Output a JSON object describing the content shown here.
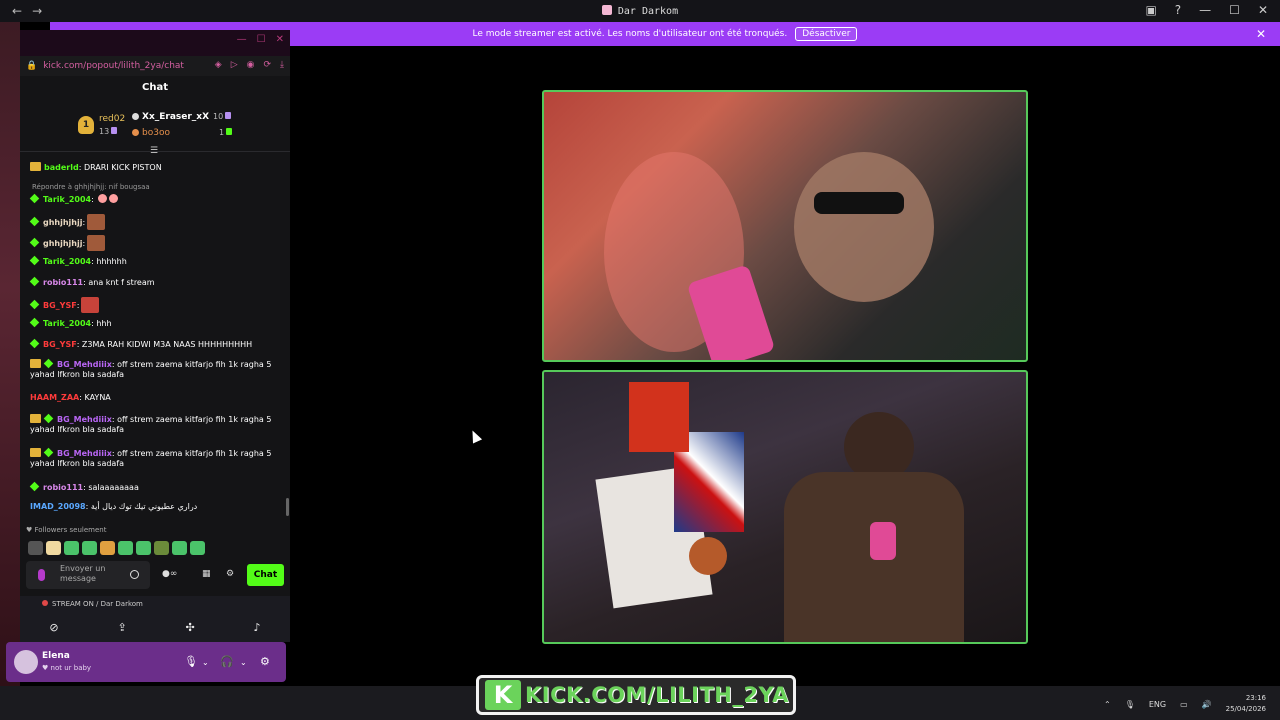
{
  "window": {
    "title": "Dar Darkom"
  },
  "banner": {
    "text": "Le mode streamer est activé. Les noms d'utilisateur ont été tronqués.",
    "button": "Désactiver"
  },
  "chat": {
    "url": "kick.com/popout/lilith_2ya/chat",
    "header": "Chat",
    "leaderboard": {
      "first": {
        "rank": "1",
        "name": "red02",
        "count": "13"
      },
      "second": {
        "name": "Xx_Eraser_xX",
        "count": "10"
      },
      "third": {
        "name": "bo3oo",
        "count": "1"
      }
    },
    "messages": [
      {
        "user": "baderld",
        "text": ": DRARI KICK PISTON"
      },
      {
        "reply": "Répondre à ghhjhjhjj: nif bougsaa"
      },
      {
        "user": "Tarik_2004",
        "text": ": "
      },
      {
        "user": "ghhjhjhjj",
        "text": ":"
      },
      {
        "user": "ghhjhjhjj",
        "text": ":"
      },
      {
        "user": "Tarik_2004",
        "text": ": hhhhhh"
      },
      {
        "user": "robio111",
        "text": ": ana knt f stream"
      },
      {
        "user": "BG_YSF",
        "text": ":"
      },
      {
        "user": "Tarik_2004",
        "text": ": hhh"
      },
      {
        "user": "BG_YSF",
        "text": ": Z3MA RAH KIDWI M3A NAAS HHHHHHHHH"
      },
      {
        "user": "BG_Mehdiiix",
        "text": ": off strem zaema kitfarjo fih 1k ragha 5 yahad lfkron bla sadafa"
      },
      {
        "user": "HAAM_ZAA",
        "text": ": KAYNA"
      },
      {
        "user": "BG_Mehdiiix",
        "text": ": off strem zaema kitfarjo fih 1k ragha 5 yahad lfkron bla sadafa"
      },
      {
        "user": "BG_Mehdiiix",
        "text": ": off strem zaema kitfarjo fih 1k ragha 5 yahad lfkron bla sadafa"
      },
      {
        "user": "robio111",
        "text": ": salaaaaaaaa"
      },
      {
        "user": "IMAD_20098",
        "text": ": دراري عطيوني تيك توك ديال أية"
      }
    ],
    "followers_only": "Followers seulement",
    "input_placeholder": "Envoyer un message",
    "send": "Chat"
  },
  "discord": {
    "stream": "STREAM ON / Dar Darkom",
    "user": {
      "name": "Elena",
      "status": "not ur baby"
    }
  },
  "tray": {
    "lang": "ENG",
    "time": "23:16",
    "date": "25/04/2026"
  },
  "watermark": {
    "logo": "K",
    "text": "KICK.COM/LILITH_2YA"
  },
  "colors": {
    "accent": "#9b3cf5",
    "kick_green": "#53fc18",
    "cam_border": "#56c95a"
  }
}
